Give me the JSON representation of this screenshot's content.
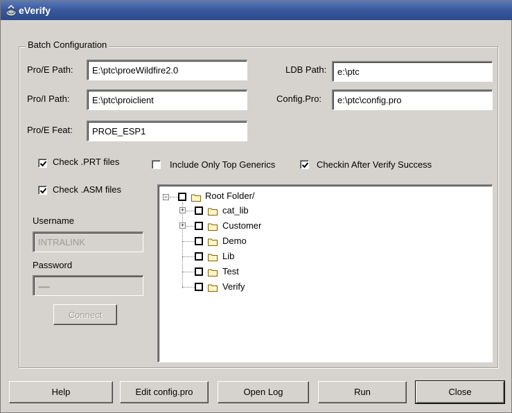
{
  "window": {
    "title": "eVerify"
  },
  "batch": {
    "legend": "Batch Configuration",
    "proe_path": {
      "label": "Pro/E Path:",
      "value": "E:\\ptc\\proeWildfire2.0"
    },
    "proi_path": {
      "label": "Pro/I Path:",
      "value": "E:\\ptc\\proiclient"
    },
    "proe_feat": {
      "label": "Pro/E Feat:",
      "value": "PROE_ESP1"
    },
    "ldb_path": {
      "label": "LDB Path:",
      "value": "e:\\ptc"
    },
    "config_pro": {
      "label": "Config.Pro:",
      "value": "e:\\ptc\\config.pro"
    }
  },
  "options": {
    "check_prt": {
      "label": "Check .PRT files",
      "checked": true
    },
    "check_asm": {
      "label": "Check .ASM files",
      "checked": true
    },
    "top_generics": {
      "label": "Include Only Top Generics",
      "checked": false
    },
    "checkin_after": {
      "label": "Checkin After Verify Success",
      "checked": true
    }
  },
  "login": {
    "username_label": "Username",
    "username_value": "INTRALINK",
    "password_label": "Password",
    "password_mask": "•••••••••",
    "connect_label": "Connect"
  },
  "tree": {
    "root": "Root Folder/",
    "children": [
      {
        "label": "cat_lib",
        "expandable": true
      },
      {
        "label": "Customer",
        "expandable": true
      },
      {
        "label": "Demo",
        "expandable": false
      },
      {
        "label": "Lib",
        "expandable": false
      },
      {
        "label": "Test",
        "expandable": false
      },
      {
        "label": "Verify",
        "expandable": false
      }
    ]
  },
  "buttons": {
    "help": "Help",
    "edit_config": "Edit config.pro",
    "open_log": "Open Log",
    "run": "Run",
    "close": "Close"
  },
  "colors": {
    "titlebar": "#3a5a9e",
    "window_bg": "#d6d3ce",
    "field_bg": "#ffffff",
    "folder": "#e8c86a"
  }
}
